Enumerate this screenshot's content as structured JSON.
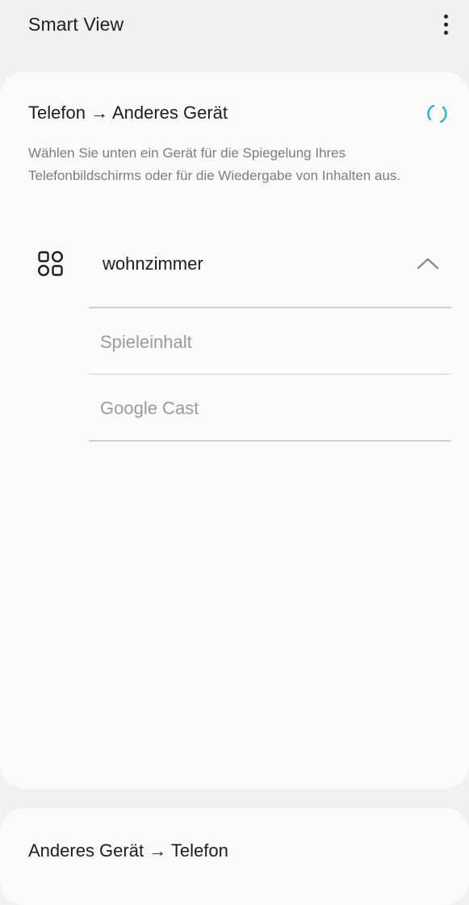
{
  "header": {
    "title": "Smart View",
    "more_icon": "more-vertical-icon"
  },
  "mirror_section": {
    "title": "Telefon → Anderes Gerät",
    "loading_icon": "loading-spinner-icon",
    "spinner_color": "#2bb3c7",
    "description": "Wählen Sie unten ein Gerät für die Spiegelung Ihres Telefonbildschirms oder für die Wiedergabe von Inhalten aus.",
    "device": {
      "name": "wohnzimmer",
      "icon": "apps-grid-icon",
      "expanded": true,
      "options": [
        {
          "label": "Spieleinhalt"
        },
        {
          "label": "Google Cast"
        }
      ]
    }
  },
  "receive_section": {
    "title": "Anderes Gerät → Telefon"
  },
  "colors": {
    "background": "#f1f1f1",
    "card": "#fbfbfb",
    "primary_text": "#1d1d1d",
    "secondary_text": "#7d7d7d",
    "option_text": "#9a9a9a",
    "divider": "#cfcfcf"
  }
}
